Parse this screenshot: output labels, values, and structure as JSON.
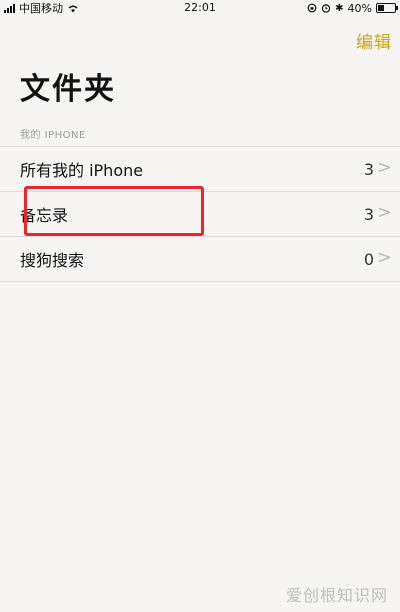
{
  "status_bar": {
    "carrier": "中国移动",
    "time": "22:01",
    "battery": "40%",
    "battery_level": 0.4
  },
  "nav": {
    "edit_label": "编辑"
  },
  "page_title": "文件夹",
  "section": {
    "header": "我的 IPHONE"
  },
  "folders": [
    {
      "label": "所有我的 iPhone",
      "count": "3"
    },
    {
      "label": "备忘录",
      "count": "3"
    },
    {
      "label": "搜狗搜索",
      "count": "0"
    }
  ],
  "watermark": "爱创根知识网",
  "colors": {
    "accent": "#d4a014",
    "highlight_box": "#e8262c",
    "background": "#f6f5f3"
  }
}
